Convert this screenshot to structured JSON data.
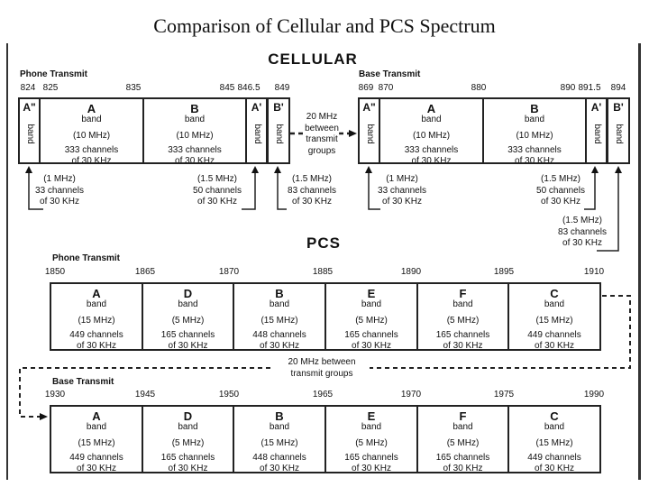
{
  "title": "Comparison of Cellular and PCS Spectrum",
  "cellular": {
    "heading": "CELLULAR",
    "gap_note": [
      "20 MHz",
      "between",
      "transmit",
      "groups"
    ],
    "phone": {
      "label": "Phone Transmit",
      "freqs": [
        "824",
        "825",
        "835",
        "845",
        "846.5",
        "849"
      ],
      "bands": [
        {
          "letter": "A\"",
          "text": "band"
        },
        {
          "letter": "A",
          "text": "band",
          "mhz": "(10 MHz)",
          "ch": [
            "333 channels",
            "of 30 KHz"
          ]
        },
        {
          "letter": "B",
          "text": "band",
          "mhz": "(10 MHz)",
          "ch": [
            "333 channels",
            "of 30 KHz"
          ]
        },
        {
          "letter": "A'",
          "text": "band"
        },
        {
          "letter": "B'",
          "text": "band"
        }
      ],
      "notes": [
        [
          "(1 MHz)",
          "33 channels",
          "of 30 KHz"
        ],
        [
          "(1.5 MHz)",
          "50 channels",
          "of 30 KHz"
        ],
        [
          "(1.5 MHz)",
          "83 channels",
          "of 30 KHz"
        ]
      ]
    },
    "base": {
      "label": "Base Transmit",
      "freqs": [
        "869",
        "870",
        "880",
        "890",
        "891.5",
        "894"
      ],
      "bands": [
        {
          "letter": "A\"",
          "text": "band"
        },
        {
          "letter": "A",
          "text": "band",
          "mhz": "(10 MHz)",
          "ch": [
            "333 channels",
            "of 30 KHz"
          ]
        },
        {
          "letter": "B",
          "text": "band",
          "mhz": "(10 MHz)",
          "ch": [
            "333 channels",
            "of 30 KHz"
          ]
        },
        {
          "letter": "A'",
          "text": "band"
        },
        {
          "letter": "B'",
          "text": "band"
        }
      ],
      "notes": [
        [
          "(1 MHz)",
          "33 channels",
          "of 30 KHz"
        ],
        [
          "(1.5 MHz)",
          "50 channels",
          "of 30 KHz"
        ],
        [
          "(1.5 MHz)",
          "83 channels",
          "of 30 KHz"
        ]
      ]
    }
  },
  "pcs": {
    "heading": "PCS",
    "gap_note": [
      "20 MHz between",
      "transmit groups"
    ],
    "phone": {
      "label": "Phone Transmit",
      "freqs": [
        "1850",
        "1865",
        "1870",
        "1885",
        "1890",
        "1895",
        "1910"
      ],
      "bands": [
        {
          "letter": "A",
          "text": "band",
          "mhz": "(15 MHz)",
          "ch": [
            "449 channels",
            "of 30 KHz"
          ]
        },
        {
          "letter": "D",
          "text": "band",
          "mhz": "(5 MHz)",
          "ch": [
            "165 channels",
            "of 30 KHz"
          ]
        },
        {
          "letter": "B",
          "text": "band",
          "mhz": "(15 MHz)",
          "ch": [
            "448 channels",
            "of 30 KHz"
          ]
        },
        {
          "letter": "E",
          "text": "band",
          "mhz": "(5 MHz)",
          "ch": [
            "165 channels",
            "of 30 KHz"
          ]
        },
        {
          "letter": "F",
          "text": "band",
          "mhz": "(5 MHz)",
          "ch": [
            "165 channels",
            "of 30 KHz"
          ]
        },
        {
          "letter": "C",
          "text": "band",
          "mhz": "(15 MHz)",
          "ch": [
            "449 channels",
            "of 30 KHz"
          ]
        }
      ]
    },
    "base": {
      "label": "Base Transmit",
      "freqs": [
        "1930",
        "1945",
        "1950",
        "1965",
        "1970",
        "1975",
        "1990"
      ],
      "bands": [
        {
          "letter": "A",
          "text": "band",
          "mhz": "(15 MHz)",
          "ch": [
            "449 channels",
            "of 30 KHz"
          ]
        },
        {
          "letter": "D",
          "text": "band",
          "mhz": "(5 MHz)",
          "ch": [
            "165 channels",
            "of 30 KHz"
          ]
        },
        {
          "letter": "B",
          "text": "band",
          "mhz": "(15 MHz)",
          "ch": [
            "448 channels",
            "of 30 KHz"
          ]
        },
        {
          "letter": "E",
          "text": "band",
          "mhz": "(5 MHz)",
          "ch": [
            "165 channels",
            "of 30 KHz"
          ]
        },
        {
          "letter": "F",
          "text": "band",
          "mhz": "(5 MHz)",
          "ch": [
            "165 channels",
            "of 30 KHz"
          ]
        },
        {
          "letter": "C",
          "text": "band",
          "mhz": "(15 MHz)",
          "ch": [
            "449 channels",
            "of 30 KHz"
          ]
        }
      ]
    }
  }
}
